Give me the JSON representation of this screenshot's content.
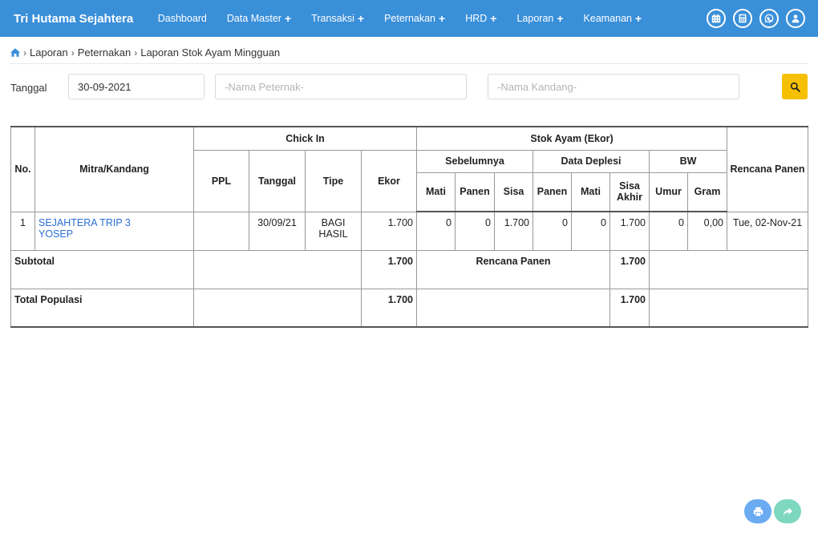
{
  "navbar": {
    "brand": "Tri Hutama Sejahtera",
    "items": [
      {
        "label": "Dashboard",
        "plus": ""
      },
      {
        "label": "Data Master",
        "plus": "+"
      },
      {
        "label": "Transaksi",
        "plus": "+"
      },
      {
        "label": "Peternakan",
        "plus": "+"
      },
      {
        "label": "HRD",
        "plus": "+"
      },
      {
        "label": "Laporan",
        "plus": "+"
      },
      {
        "label": "Keamanan",
        "plus": "+"
      }
    ],
    "right_icons": [
      "calendar-icon",
      "calculator-icon",
      "whatsapp-icon",
      "user-icon"
    ]
  },
  "breadcrumb": {
    "home_icon": "home-icon",
    "items": [
      "Laporan",
      "Peternakan",
      "Laporan Stok Ayam Mingguan"
    ],
    "separator": "›"
  },
  "filters": {
    "tanggal_label": "Tanggal",
    "tanggal_value": "30-09-2021",
    "peternak_placeholder": "-Nama Peternak-",
    "kandang_placeholder": "-Nama Kandang-",
    "search_icon": "search-icon"
  },
  "table": {
    "headers": {
      "no": "No.",
      "mitra": "Mitra/Kandang",
      "chick_in": "Chick In",
      "ppl": "PPL",
      "tanggal": "Tanggal",
      "tipe": "Tipe",
      "ekor": "Ekor",
      "stok_ayam": "Stok Ayam (Ekor)",
      "sebelumnya": "Sebelumnya",
      "data_deplesi": "Data Deplesi",
      "bw": "BW",
      "mati": "Mati",
      "panen": "Panen",
      "sisa": "Sisa",
      "sisa_akhir": "Sisa Akhir",
      "umur": "Umur",
      "gram": "Gram",
      "rencana_panen": "Rencana Panen"
    },
    "rows": [
      {
        "no": "1",
        "mitra_line1": "SEJAHTERA TRIP 3",
        "mitra_line2": "YOSEP",
        "ppl": "",
        "tanggal": "30/09/21",
        "tipe_line1": "BAGI",
        "tipe_line2": "HASIL",
        "ekor": "1.700",
        "seb_mati": "0",
        "seb_panen": "0",
        "seb_sisa": "1.700",
        "dep_panen": "0",
        "dep_mati": "0",
        "sisa_akhir": "1.700",
        "umur": "0",
        "gram": "0,00",
        "rencana_panen": "Tue, 02-Nov-21"
      }
    ],
    "subtotal": {
      "label": "Subtotal",
      "ekor": "1.700",
      "rencana_label": "Rencana Panen",
      "sisa_akhir": "1.700"
    },
    "total": {
      "label": "Total Populasi",
      "ekor": "1.700",
      "sisa_akhir": "1.700"
    }
  },
  "fab": {
    "print_icon": "print-icon",
    "share_icon": "share-icon"
  }
}
